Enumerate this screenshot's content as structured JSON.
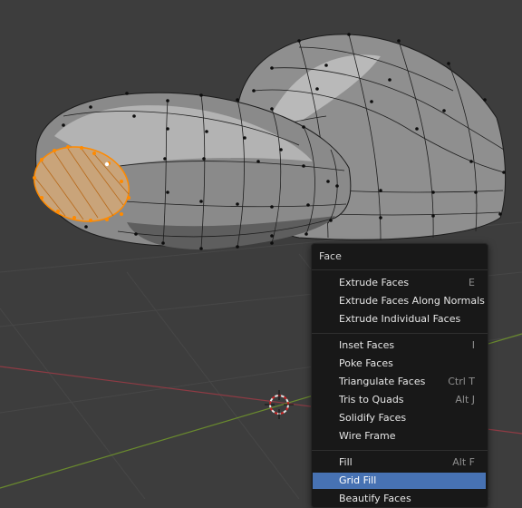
{
  "menu": {
    "title": "Face",
    "items": [
      {
        "label": "Extrude Faces",
        "shortcut": "E"
      },
      {
        "label": "Extrude Faces Along Normals",
        "shortcut": ""
      },
      {
        "label": "Extrude Individual Faces",
        "shortcut": ""
      },
      {
        "label": "Inset Faces",
        "shortcut": "I"
      },
      {
        "label": "Poke Faces",
        "shortcut": ""
      },
      {
        "label": "Triangulate Faces",
        "shortcut": "Ctrl T"
      },
      {
        "label": "Tris to Quads",
        "shortcut": "Alt J"
      },
      {
        "label": "Solidify Faces",
        "shortcut": ""
      },
      {
        "label": "Wire Frame",
        "shortcut": ""
      },
      {
        "label": "Fill",
        "shortcut": "Alt F"
      },
      {
        "label": "Grid Fill",
        "shortcut": ""
      },
      {
        "label": "Beautify Faces",
        "shortcut": ""
      }
    ],
    "highlighted": "Grid Fill"
  },
  "colors": {
    "viewport_bg": "#3d3d3d",
    "mesh_face": "#9a9a9a",
    "selected_face": "#c9a47a",
    "selected_edge": "#ff8a00",
    "x_axis": "#8e3b44",
    "y_axis": "#6a8b2e",
    "menu_bg": "#181818",
    "highlight": "#4772b3"
  }
}
